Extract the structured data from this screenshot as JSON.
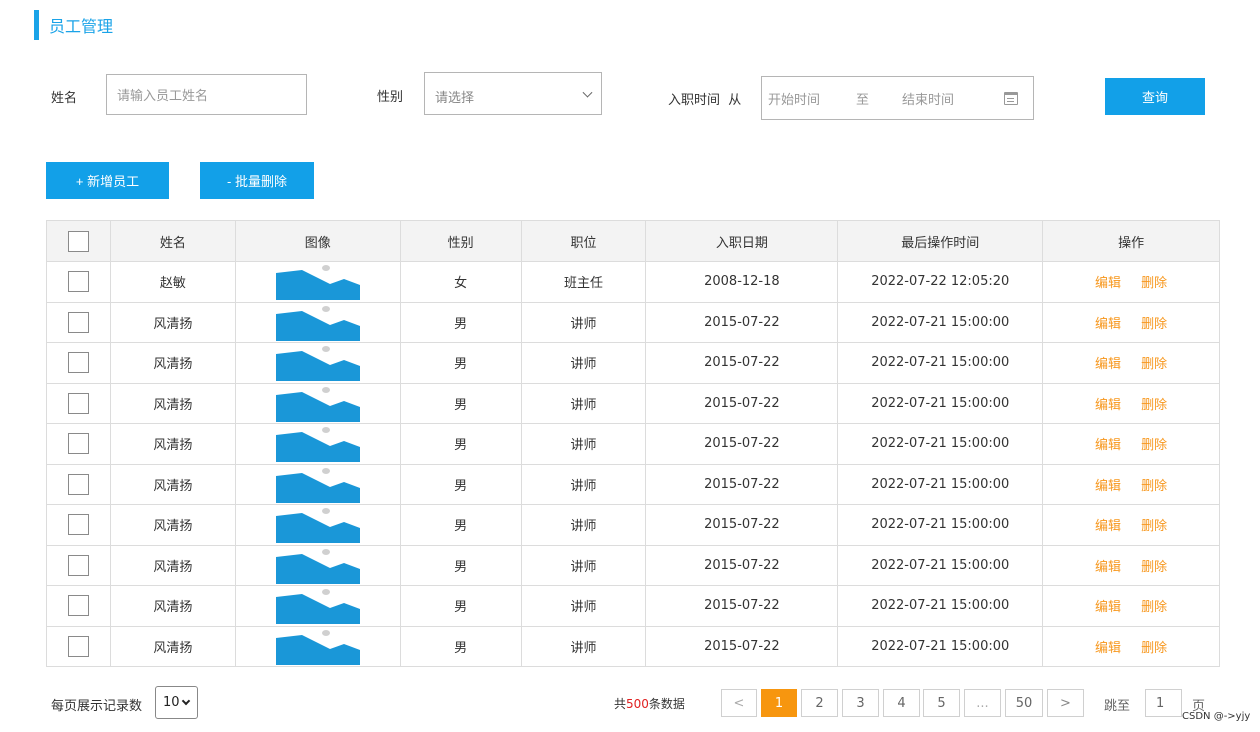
{
  "page": {
    "title": "员工管理"
  },
  "filters": {
    "name_label": "姓名",
    "name_placeholder": "请输入员工姓名",
    "gender_label": "性别",
    "gender_value": "请选择",
    "hire_label": "入职时间  从",
    "start_placeholder": "开始时间",
    "range_sep": "至",
    "end_placeholder": "结束时间",
    "query_button": "查询"
  },
  "actions": {
    "add_button": "+ 新增员工",
    "batch_delete_button": "- 批量删除"
  },
  "table": {
    "headers": [
      "姓名",
      "图像",
      "性别",
      "职位",
      "入职日期",
      "最后操作时间",
      "操作"
    ],
    "edit_label": "编辑",
    "delete_label": "删除",
    "rows": [
      {
        "name": "赵敏",
        "gender": "女",
        "position": "班主任",
        "hire_date": "2008-12-18",
        "last_op": "2022-07-22 12:05:20"
      },
      {
        "name": "风清扬",
        "gender": "男",
        "position": "讲师",
        "hire_date": "2015-07-22",
        "last_op": "2022-07-21 15:00:00"
      },
      {
        "name": "风清扬",
        "gender": "男",
        "position": "讲师",
        "hire_date": "2015-07-22",
        "last_op": "2022-07-21 15:00:00"
      },
      {
        "name": "风清扬",
        "gender": "男",
        "position": "讲师",
        "hire_date": "2015-07-22",
        "last_op": "2022-07-21 15:00:00"
      },
      {
        "name": "风清扬",
        "gender": "男",
        "position": "讲师",
        "hire_date": "2015-07-22",
        "last_op": "2022-07-21 15:00:00"
      },
      {
        "name": "风清扬",
        "gender": "男",
        "position": "讲师",
        "hire_date": "2015-07-22",
        "last_op": "2022-07-21 15:00:00"
      },
      {
        "name": "风清扬",
        "gender": "男",
        "position": "讲师",
        "hire_date": "2015-07-22",
        "last_op": "2022-07-21 15:00:00"
      },
      {
        "name": "风清扬",
        "gender": "男",
        "position": "讲师",
        "hire_date": "2015-07-22",
        "last_op": "2022-07-21 15:00:00"
      },
      {
        "name": "风清扬",
        "gender": "男",
        "position": "讲师",
        "hire_date": "2015-07-22",
        "last_op": "2022-07-21 15:00:00"
      },
      {
        "name": "风清扬",
        "gender": "男",
        "position": "讲师",
        "hire_date": "2015-07-22",
        "last_op": "2022-07-21 15:00:00"
      }
    ]
  },
  "pagination": {
    "per_page_label": "每页展示记录数",
    "per_page_value": "10",
    "total_prefix": "共",
    "total_count": "500",
    "total_suffix": "条数据",
    "prev": "<",
    "pages": [
      "1",
      "2",
      "3",
      "4",
      "5",
      "...",
      "50"
    ],
    "active_page": "1",
    "next": ">",
    "jump_label": "跳至",
    "jump_value": "1",
    "jump_suffix": "页"
  },
  "watermark": "CSDN @->yjy",
  "colors": {
    "accent_blue": "#12a0e8",
    "orange": "#f7960f",
    "red": "#e02020"
  }
}
